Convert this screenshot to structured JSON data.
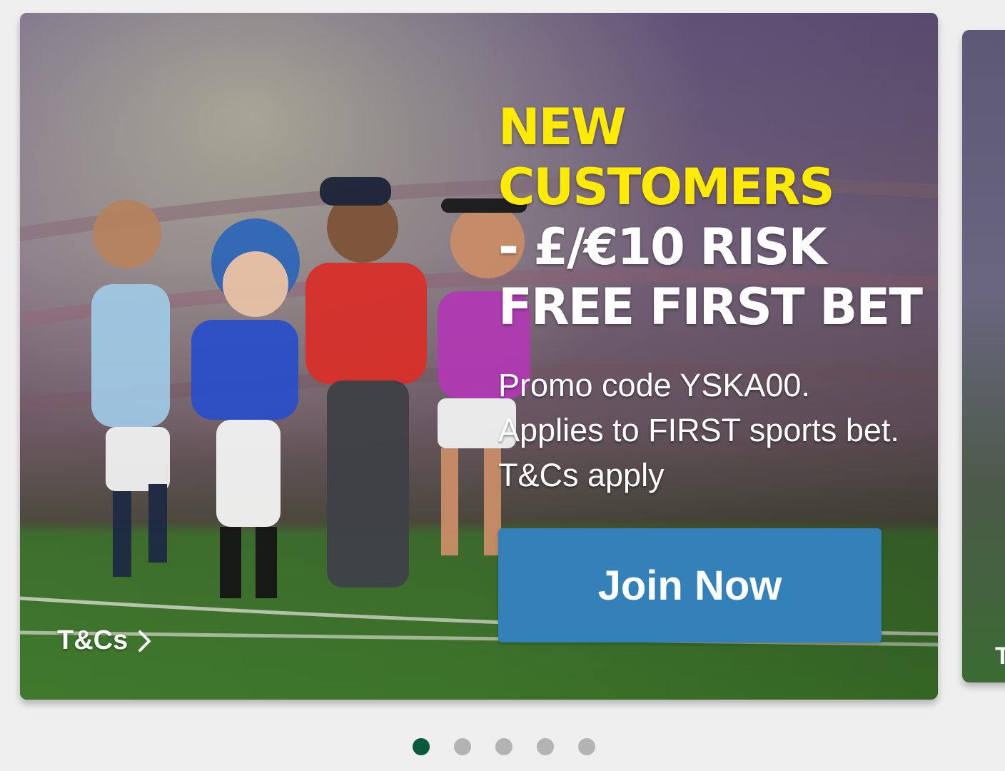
{
  "carousel": {
    "slides": [
      {
        "headline_yellow": "NEW CUSTOMERS",
        "headline_white": " - £/€10 RISK FREE FIRST BET",
        "promo_text": "Promo code YSKA00. Applies to FIRST sports bet. T&Cs apply",
        "cta_label": "Join Now",
        "tcs_label": "T&Cs",
        "image": "sports-stars-stadium-illustration"
      }
    ],
    "next_slide_peek_text": "T",
    "dots": {
      "count": 5,
      "active_index": 0
    }
  },
  "colors": {
    "headline_accent": "#ffeb00",
    "cta_background": "#3381b8",
    "dot_active": "#0b5a3c",
    "dot_inactive": "#b3b3b3",
    "page_background": "#efefef"
  },
  "icons": {
    "tcs_arrow": "chevron-right-icon"
  }
}
